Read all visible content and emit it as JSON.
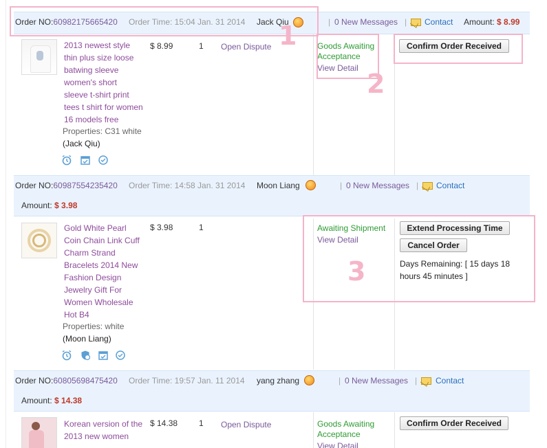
{
  "orders": [
    {
      "order_label": "Order NO:",
      "order_no": "60982175665420",
      "order_time": "Order Time: 15:04 Jan. 31 2014",
      "buyer": "Jack Qiu",
      "messages": "0 New Messages",
      "contact": "Contact",
      "amount_label": "Amount:",
      "amount": "$ 8.99",
      "product_title": [
        "2013 newest style",
        "thin plus size loose",
        "batwing sleeve",
        "women's short",
        "sleeve t-shirt print",
        "tees t shirt for women",
        "16 models free"
      ],
      "properties": "Properties: C31 white",
      "buyer_paren": "(Jack Qiu)",
      "price": "$ 8.99",
      "qty": "1",
      "action": "Open Dispute",
      "status": [
        "Goods Awaiting",
        "Acceptance"
      ],
      "view_detail": "View Detail",
      "button": "Confirm Order Received"
    },
    {
      "order_label": "Order NO:",
      "order_no": "60987554235420",
      "order_time": "Order Time: 14:58 Jan. 31 2014",
      "buyer": "Moon Liang",
      "messages": "0 New Messages",
      "contact": "Contact",
      "amount_label": "Amount:",
      "amount": "$ 3.98",
      "product_title": [
        "Gold White Pearl",
        "Coin Chain Link Cuff",
        "Charm Strand",
        "Bracelets 2014 New",
        "Fashion Design",
        "Jewelry Gift For",
        "Women Wholesale",
        "Hot B4"
      ],
      "properties": "Properties: white",
      "buyer_paren": "(Moon Liang)",
      "price": "$ 3.98",
      "qty": "1",
      "status": [
        "Awaiting Shipment"
      ],
      "view_detail": "View Detail",
      "button1": "Extend Processing Time",
      "button2": "Cancel Order",
      "days_remaining": [
        "Days Remaining: [ 15 days 18",
        "hours 45 minutes ]"
      ]
    },
    {
      "order_label": "Order NO:",
      "order_no": "60805698475420",
      "order_time": "Order Time: 19:57 Jan. 11 2014",
      "buyer": "yang zhang",
      "messages": "0 New Messages",
      "contact": "Contact",
      "amount_label": "Amount:",
      "amount": "$ 14.38",
      "product_title": [
        "Korean version of the",
        "2013 new women"
      ],
      "price": "$ 14.38",
      "qty": "1",
      "action": "Open Dispute",
      "status": [
        "Goods Awaiting",
        "Acceptance"
      ],
      "view_detail": "View Detail",
      "button": "Confirm Order Received"
    }
  ],
  "annotations": {
    "n1": "1",
    "n2": "2",
    "n3": "3"
  },
  "colors": {
    "header_bg": "#eaf3fd",
    "link_purple": "#8d4c9b",
    "status_green": "#2e9b33",
    "amount_red": "#c0392b",
    "annotation_pink": "#f4b3c9"
  }
}
